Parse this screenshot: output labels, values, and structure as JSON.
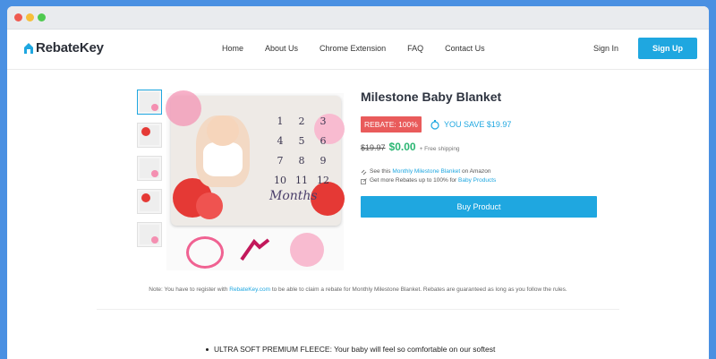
{
  "header": {
    "logo_text": "RebateKey",
    "nav": [
      "Home",
      "About Us",
      "Chrome Extension",
      "FAQ",
      "Contact Us"
    ],
    "signin_label": "Sign In",
    "signup_label": "Sign Up"
  },
  "product": {
    "title": "Milestone Baby Blanket",
    "rebate_badge": "REBATE: 100%",
    "save_text": "YOU SAVE $19.97",
    "old_price": "$19.97",
    "new_price": "$0.00",
    "shipping": "+ Free shipping",
    "see_prefix": "See this",
    "see_link": "Monthly Milestone Blanket",
    "see_suffix": "on Amazon",
    "more_prefix": "Get more Rebates up to 100% for",
    "more_link": "Baby Products",
    "buy_label": "Buy Product",
    "blanket_numbers": [
      "1",
      "2",
      "3",
      "4",
      "5",
      "6",
      "7",
      "8",
      "9",
      "10",
      "11",
      "12"
    ],
    "months_text": "Months"
  },
  "note": {
    "prefix": "Note: You have to register with",
    "link": "RebateKey.com",
    "suffix": "to be able to claim a rebate for Monthly Milestone Blanket. Rebates are guaranteed as long as you follow the rules."
  },
  "description": {
    "bullet_1": "ULTRA SOFT PREMIUM FLEECE: Your baby will feel so comfortable on our softest"
  },
  "colors": {
    "accent": "#1fa7e0",
    "rebate": "#e95b5b",
    "price": "#2bb673"
  },
  "icons": [
    "logo-house-icon",
    "piggy-bank-icon",
    "link-icon",
    "external-link-icon"
  ]
}
